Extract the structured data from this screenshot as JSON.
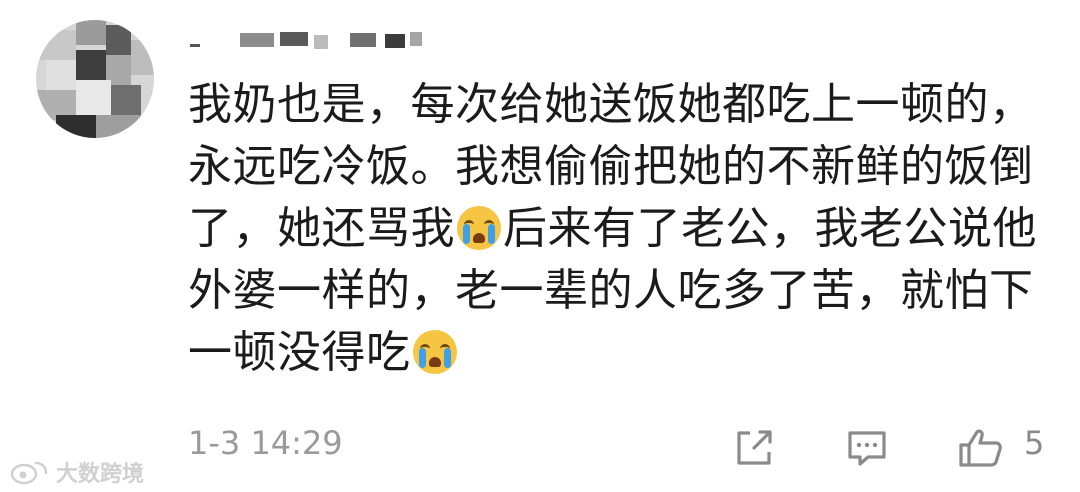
{
  "comment": {
    "lines": [
      "我奶也是，每次给她送饭她都吃上一顿的，",
      "永远吃冷饭。我想偷偷把她的不新鲜的饭倒",
      "了，她还骂我",
      "后来有了老公，我老公说他",
      "外婆一样的，老一辈的人吃多了苦，就怕下",
      "一顿没得吃"
    ],
    "emojis": [
      "crying-face-emoji",
      "crying-face-emoji"
    ]
  },
  "meta": {
    "timestamp": "1-3 14:29",
    "like_count": "5"
  },
  "icons": {
    "share": "share-icon",
    "reply": "comment-icon",
    "like": "thumbs-up-icon",
    "watermark_logo": "weibo-logo-icon"
  },
  "watermark": {
    "text": "大数跨境"
  },
  "colors": {
    "text": "#1b1b1b",
    "muted": "#9a9a9a",
    "icon": "#8a8a8a",
    "emoji": "#f6c542"
  }
}
